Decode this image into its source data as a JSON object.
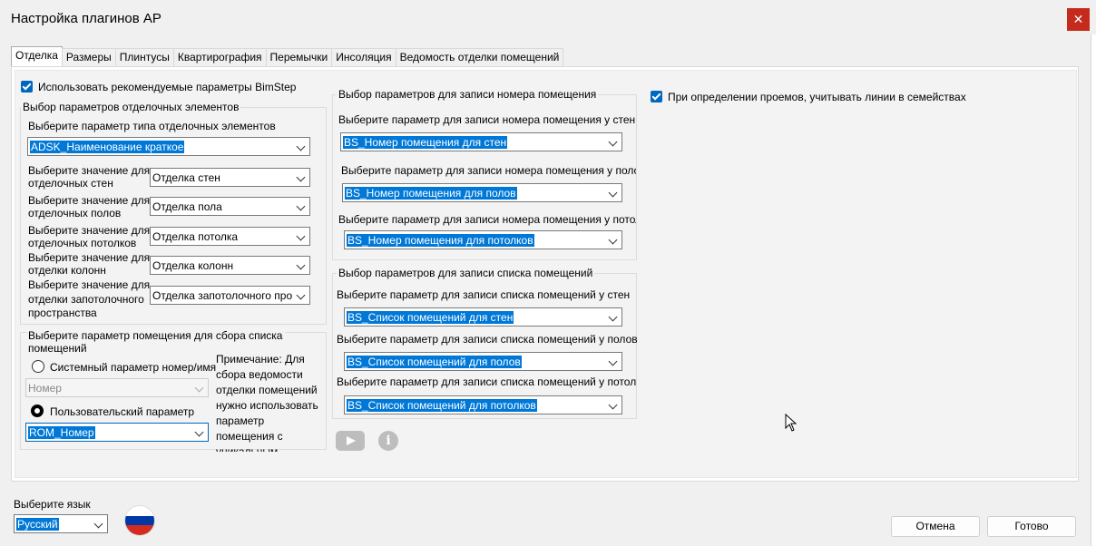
{
  "window": {
    "title": "Настройка плагинов AP",
    "close_label": "✕"
  },
  "tabs": [
    {
      "label": "Отделка",
      "active": true
    },
    {
      "label": "Размеры"
    },
    {
      "label": "Плинтусы"
    },
    {
      "label": "Квартирография"
    },
    {
      "label": "Перемычки"
    },
    {
      "label": "Инсоляция"
    },
    {
      "label": "Ведомость отделки помещений"
    }
  ],
  "finishing": {
    "use_recommended_label": "Использовать рекомендуемые параметры BimStep",
    "params_group_title": "Выбор параметров отделочных элементов",
    "type_param_label": "Выберите параметр типа отделочных элементов",
    "type_param_value": "ADSK_Наименование краткое",
    "rows": [
      {
        "label": "Выберите значение для\nотделочных стен",
        "value": "Отделка стен"
      },
      {
        "label": "Выберите значение для\nотделочных полов",
        "value": "Отделка пола"
      },
      {
        "label": "Выберите значение для\nотделочных потолков",
        "value": "Отделка потолка"
      },
      {
        "label": "Выберите значение для\nотделки колонн",
        "value": "Отделка колонн"
      },
      {
        "label": "Выберите значение для\nотделки запотолочного\nпространства",
        "value": "Отделка запотолочного про"
      }
    ],
    "room_group_title": "Выберите параметр помещения для сбора списка\nпомещений",
    "system_param_label": "Системный параметр номер/имя",
    "system_param_value": "Номер",
    "user_param_label": "Пользовательский параметр",
    "user_param_value": "ROM_Номер",
    "note": "Примечание: Для сбора ведомости отделки помещений нужно использовать параметр помещения с уникальным"
  },
  "room_number": {
    "title": "Выбор параметров для записи номера помещения",
    "walls_label": "Выберите параметр для записи номера помещения у стен",
    "walls_value": "BS_Номер помещения для стен",
    "floors_label": "Выберите параметр для записи номера помещения у полов",
    "floors_value": "BS_Номер помещения для полов",
    "ceilings_label": "Выберите параметр для записи номера помещения у потолков",
    "ceilings_value": "BS_Номер помещения для потолков"
  },
  "room_list": {
    "title": "Выбор параметров для записи списка помещений",
    "walls_label": "Выберите параметр для записи списка помещений у стен",
    "walls_value": "BS_Список помещений для стен",
    "floors_label": "Выберите параметр для записи списка помещений у полов",
    "floors_value": "BS_Список помещений для полов",
    "ceilings_label": "Выберите параметр для записи списка помещений у потолков",
    "ceilings_value": "BS_Список помещений для потолков"
  },
  "openings_label": "При определении проемов, учитывать линии в семействах",
  "language": {
    "label": "Выберите язык",
    "value": "Русский"
  },
  "buttons": {
    "cancel": "Отмена",
    "ok": "Готово"
  },
  "colors": {
    "accent": "#0067c0",
    "selection": "#0078d7",
    "close": "#c42b1c",
    "youtube_icon": "#bdbdbd"
  }
}
